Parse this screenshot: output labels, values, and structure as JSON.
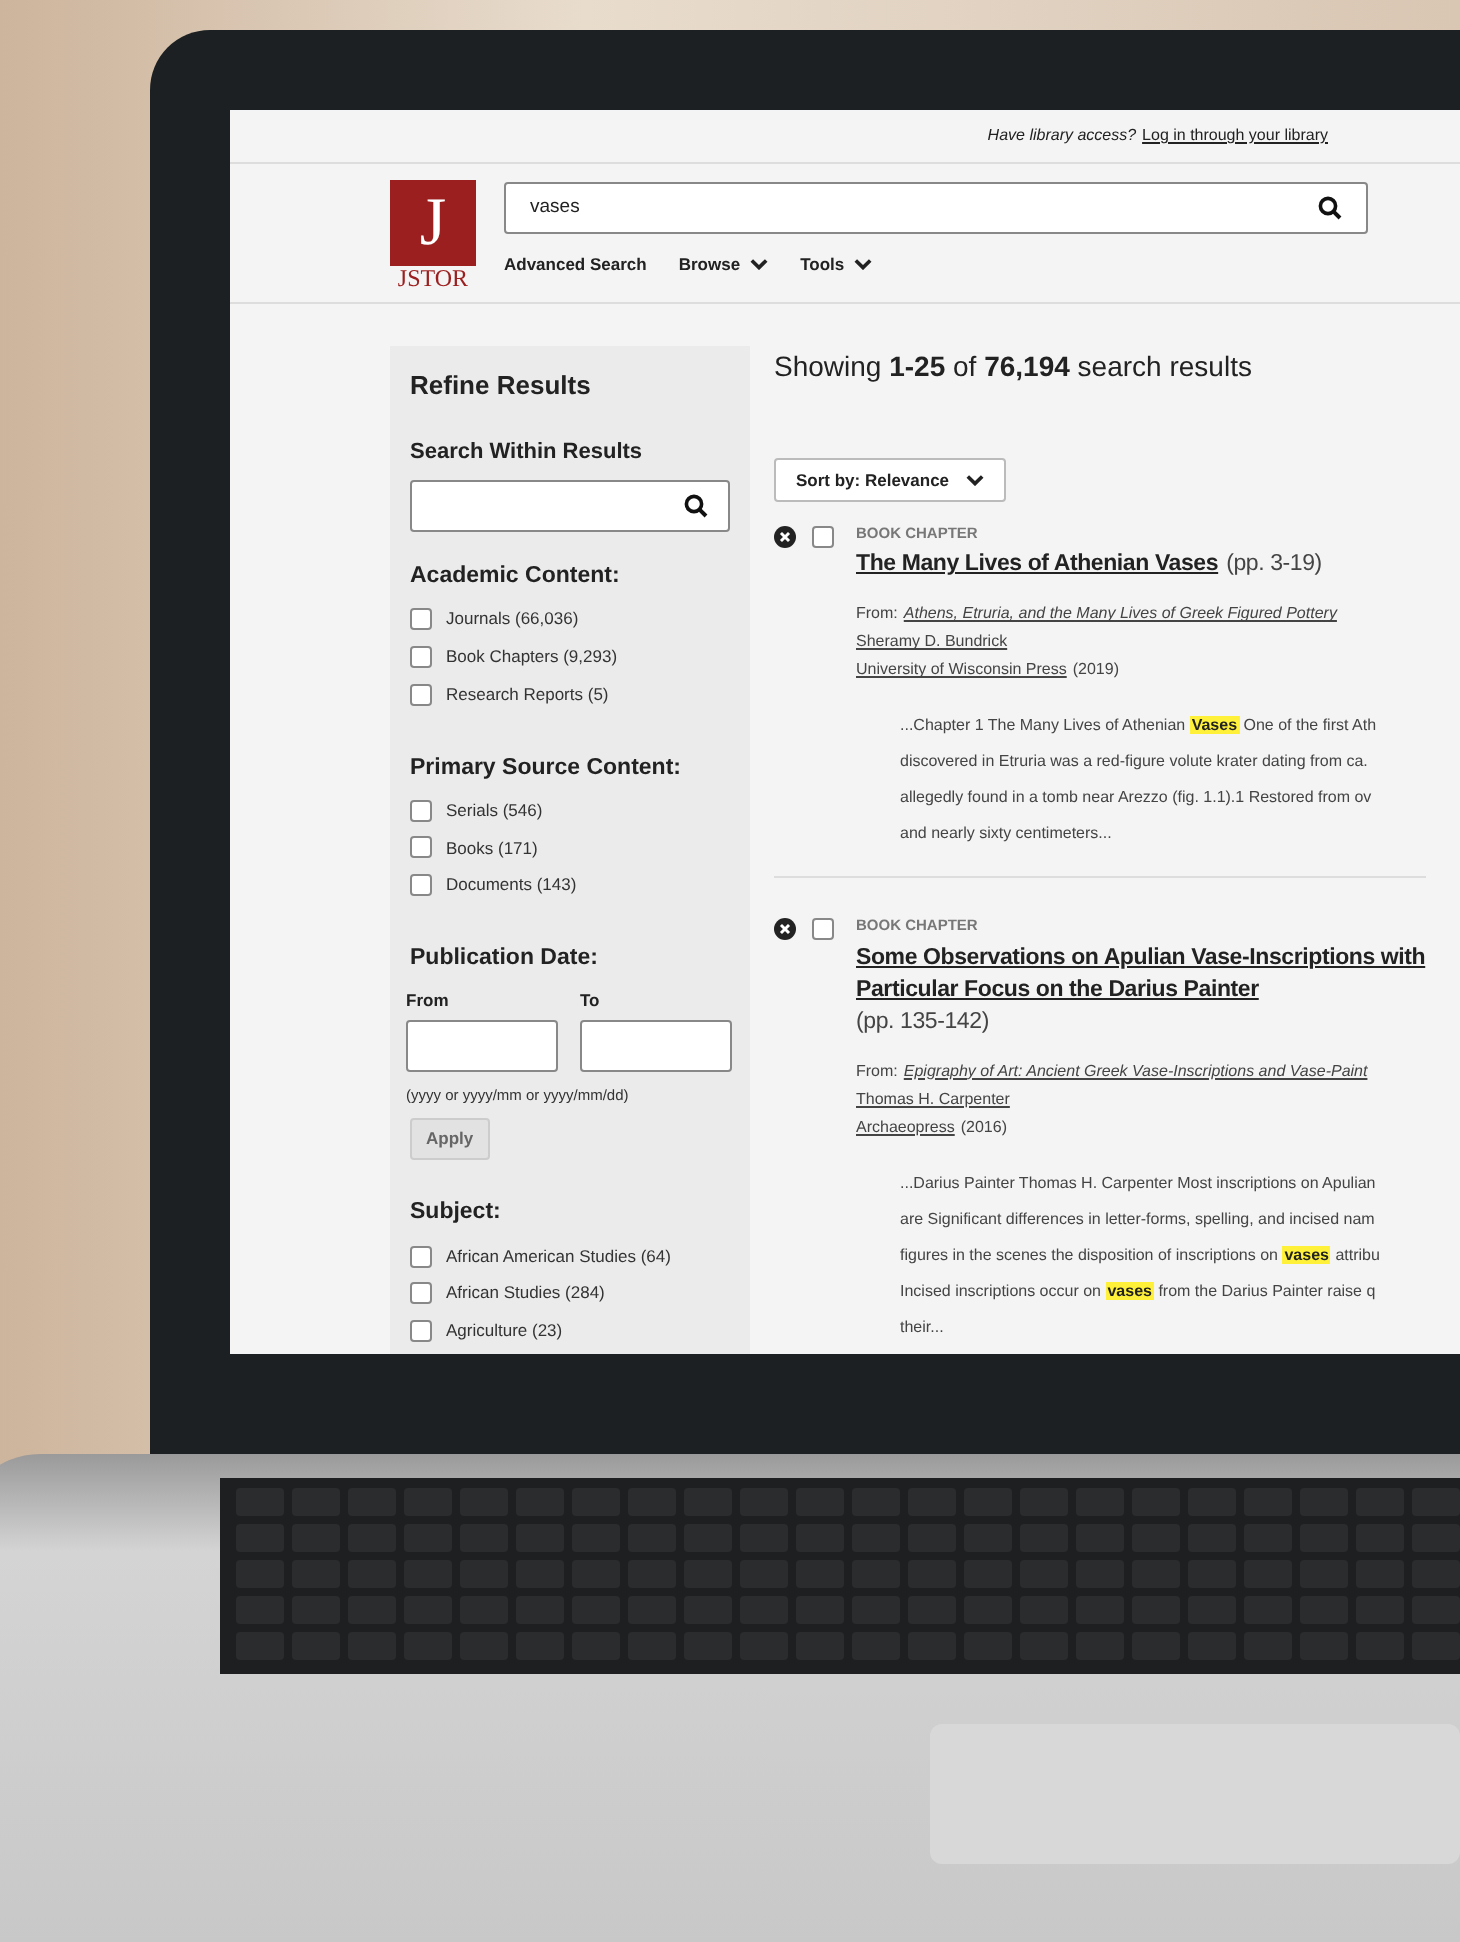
{
  "top_bar": {
    "prompt": "Have library access?",
    "link": "Log in through your library"
  },
  "header": {
    "logo_mark": "J",
    "logo_text": "JSTOR",
    "search": {
      "value": "vases"
    },
    "nav": [
      {
        "label": "Advanced Search",
        "dropdown": false
      },
      {
        "label": "Browse",
        "dropdown": true
      },
      {
        "label": "Tools",
        "dropdown": true
      }
    ]
  },
  "sidebar": {
    "title": "Refine Results",
    "search_within": {
      "label": "Search Within Results"
    },
    "sections": [
      {
        "kind": "checklist",
        "title": "Academic Content:",
        "items": [
          {
            "label": "Journals (66,036)",
            "checked": false
          },
          {
            "label": "Book Chapters (9,293)",
            "checked": false
          },
          {
            "label": "Research Reports (5)",
            "checked": false
          }
        ]
      },
      {
        "kind": "checklist",
        "title": "Primary Source Content:",
        "items": [
          {
            "label": "Serials (546)",
            "checked": false
          },
          {
            "label": "Books (171)",
            "checked": false
          },
          {
            "label": "Documents (143)",
            "checked": false
          }
        ]
      },
      {
        "kind": "date",
        "title": "Publication Date:",
        "from_label": "From",
        "to_label": "To",
        "hint": "(yyyy or yyyy/mm or yyyy/mm/dd)",
        "button": "Apply"
      },
      {
        "kind": "checklist",
        "title": "Subject:",
        "items": [
          {
            "label": "African American Studies (64)",
            "checked": false
          },
          {
            "label": "African Studies (284)",
            "checked": false
          },
          {
            "label": "Agriculture (23)",
            "checked": false
          }
        ]
      }
    ]
  },
  "results": {
    "summary": "Showing **1-25** of **76,194** search results",
    "sort": "Sort by: Relevance",
    "items": [
      {
        "type": "BOOK CHAPTER",
        "checked": false,
        "title_lines": [
          "The Many Lives of Athenian Vases"
        ],
        "pages": "(pp. 3-19)",
        "pages_on_own_line": false,
        "from_label": "From:",
        "source": "Athens, Etruria, and the Many Lives of Greek Figured Pottery",
        "author": "Sheramy D. Bundrick",
        "publisher": "University of Wisconsin Press",
        "year": "(2019)",
        "snippet_lines": [
          "...Chapter 1 The Many Lives of Athenian **Vases** One of the first Ath",
          "discovered in Etruria was a red-figure volute krater dating from ca.",
          "allegedly found in a tomb near Arezzo (fig. 1.1).1 Restored from ov",
          "and nearly sixty centimeters..."
        ]
      },
      {
        "type": "BOOK CHAPTER",
        "checked": false,
        "title_lines": [
          "Some Observations on Apulian Vase-Inscriptions with",
          "Particular Focus on the Darius Painter"
        ],
        "pages": "(pp. 135-142)",
        "pages_on_own_line": true,
        "from_label": "From:",
        "source": "Epigraphy of Art: Ancient Greek Vase-Inscriptions and Vase-Paint",
        "author": "Thomas H. Carpenter",
        "publisher": "Archaeopress",
        "year": "(2016)",
        "snippet_lines": [
          "...Darius Painter Thomas H. Carpenter Most inscriptions on Apulian",
          "are Significant differences in letter-forms, spelling, and incised nam",
          "figures in the scenes the disposition of inscriptions on **vases** attribu",
          "Incised inscriptions occur on **vases** from the Darius Painter raise q",
          "their..."
        ]
      }
    ]
  }
}
